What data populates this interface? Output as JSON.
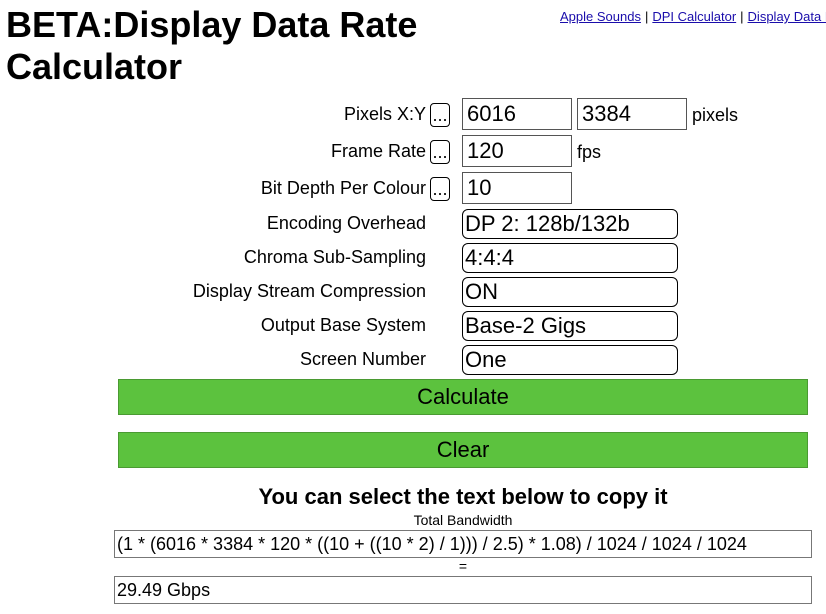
{
  "page": {
    "title": "BETA:Display Data Rate Calculator"
  },
  "top_links": [
    {
      "label": "Apple Sounds"
    },
    {
      "label": "DPI Calculator"
    },
    {
      "label": "Display Data R"
    }
  ],
  "form": {
    "pixels": {
      "label": "Pixels X:Y",
      "dots": "...",
      "x": "6016",
      "y": "3384",
      "unit": "pixels"
    },
    "frame_rate": {
      "label": "Frame Rate",
      "dots": "...",
      "value": "120",
      "unit": "fps"
    },
    "bit_depth": {
      "label": "Bit Depth Per Colour",
      "dots": "...",
      "value": "10"
    },
    "encoding_overhead": {
      "label": "Encoding Overhead",
      "value": "DP 2: 128b/132b"
    },
    "chroma": {
      "label": "Chroma Sub-Sampling",
      "value": "4:4:4"
    },
    "dsc": {
      "label": "Display Stream Compression",
      "value": "ON"
    },
    "base_system": {
      "label": "Output Base System",
      "value": "Base-2 Gigs"
    },
    "screen_number": {
      "label": "Screen Number",
      "value": "One"
    }
  },
  "buttons": {
    "calculate": "Calculate",
    "clear": "Clear"
  },
  "results": {
    "hint": "You can select the text below to copy it",
    "total_label": "Total Bandwidth",
    "formula": "(1 * (6016 * 3384 * 120 * ((10 + ((10 * 2) / 1))) / 2.5) * 1.08) / 1024 / 1024 / 1024",
    "equals": "=",
    "result": "29.49 Gbps"
  }
}
